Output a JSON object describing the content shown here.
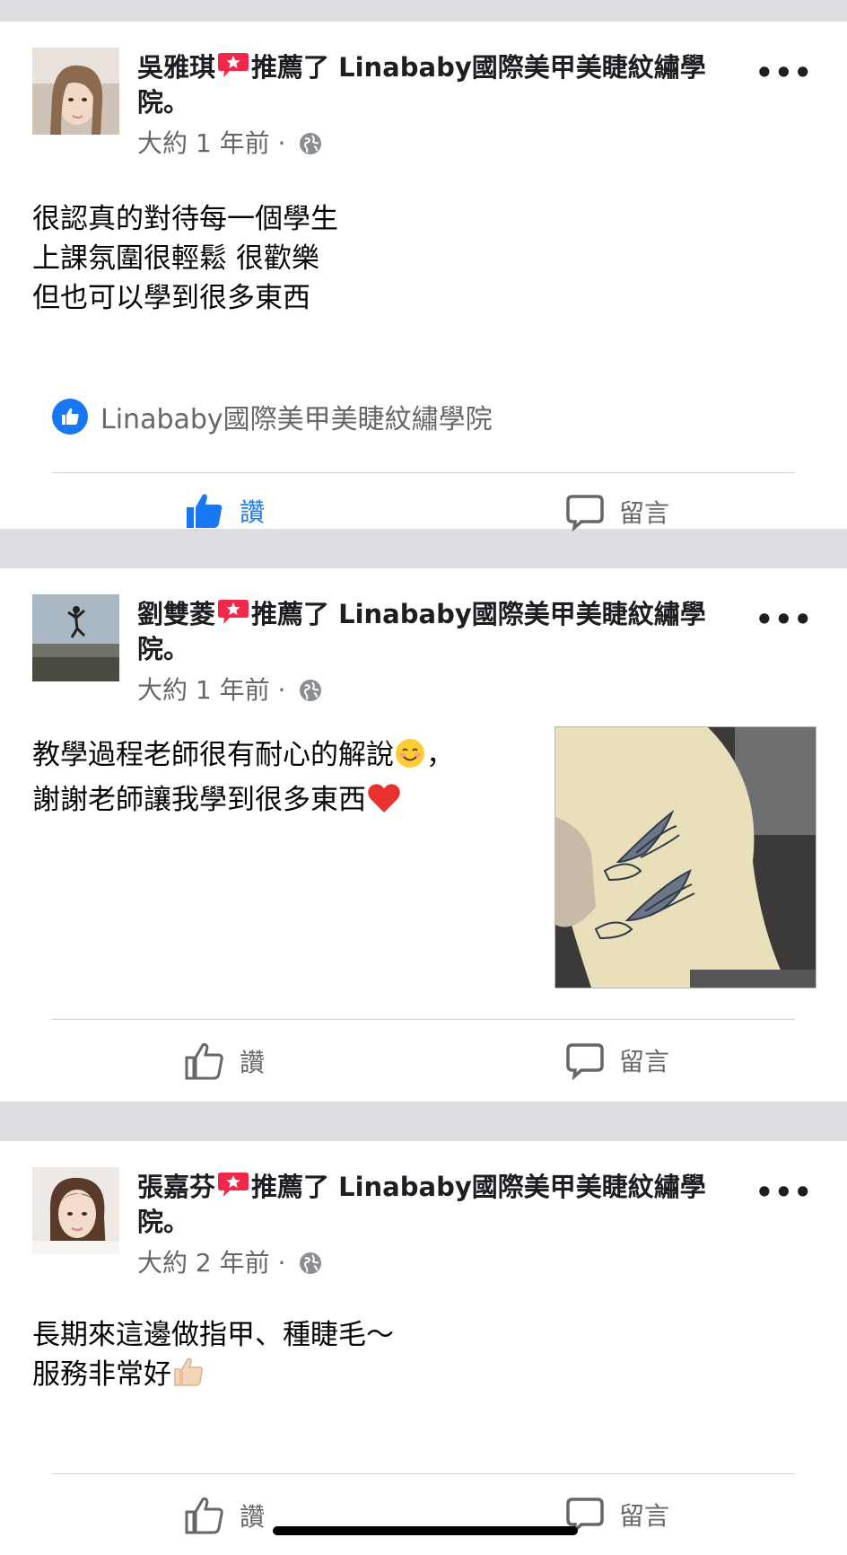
{
  "posts": [
    {
      "author": "吳雅琪",
      "recommend_text": "推薦了 Linababy國際美甲美睫紋繡學院。",
      "time": "大約 1 年前 ·",
      "body_lines": [
        "很認真的對待每一個學生",
        "上課氛圍很輕鬆 很歡樂",
        "但也可以學到很多東西"
      ],
      "liked_by": "Linababy國際美甲美睫紋繡學院",
      "like_label": "讚",
      "comment_label": "留言",
      "liked": true
    },
    {
      "author": "劉雙菱",
      "recommend_text": "推薦了 Linababy國際美甲美睫紋繡學院。",
      "time": "大約 1 年前 ·",
      "body_lines": [
        "教學過程老師很有耐心的解說",
        "謝謝老師讓我學到很多東西"
      ],
      "like_label": "讚",
      "comment_label": "留言",
      "liked": false
    },
    {
      "author": "張嘉芬",
      "recommend_text": "推薦了 Linababy國際美甲美睫紋繡學院。",
      "time": "大約 2 年前 ·",
      "body_lines": [
        "長期來這邊做指甲、種睫毛～",
        "服務非常好"
      ],
      "like_label": "讚",
      "comment_label": "留言",
      "liked": false
    }
  ],
  "colors": {
    "facebook_blue": "#1877f2",
    "recommend_red": "#f02849",
    "secondary_text": "#65676b"
  }
}
